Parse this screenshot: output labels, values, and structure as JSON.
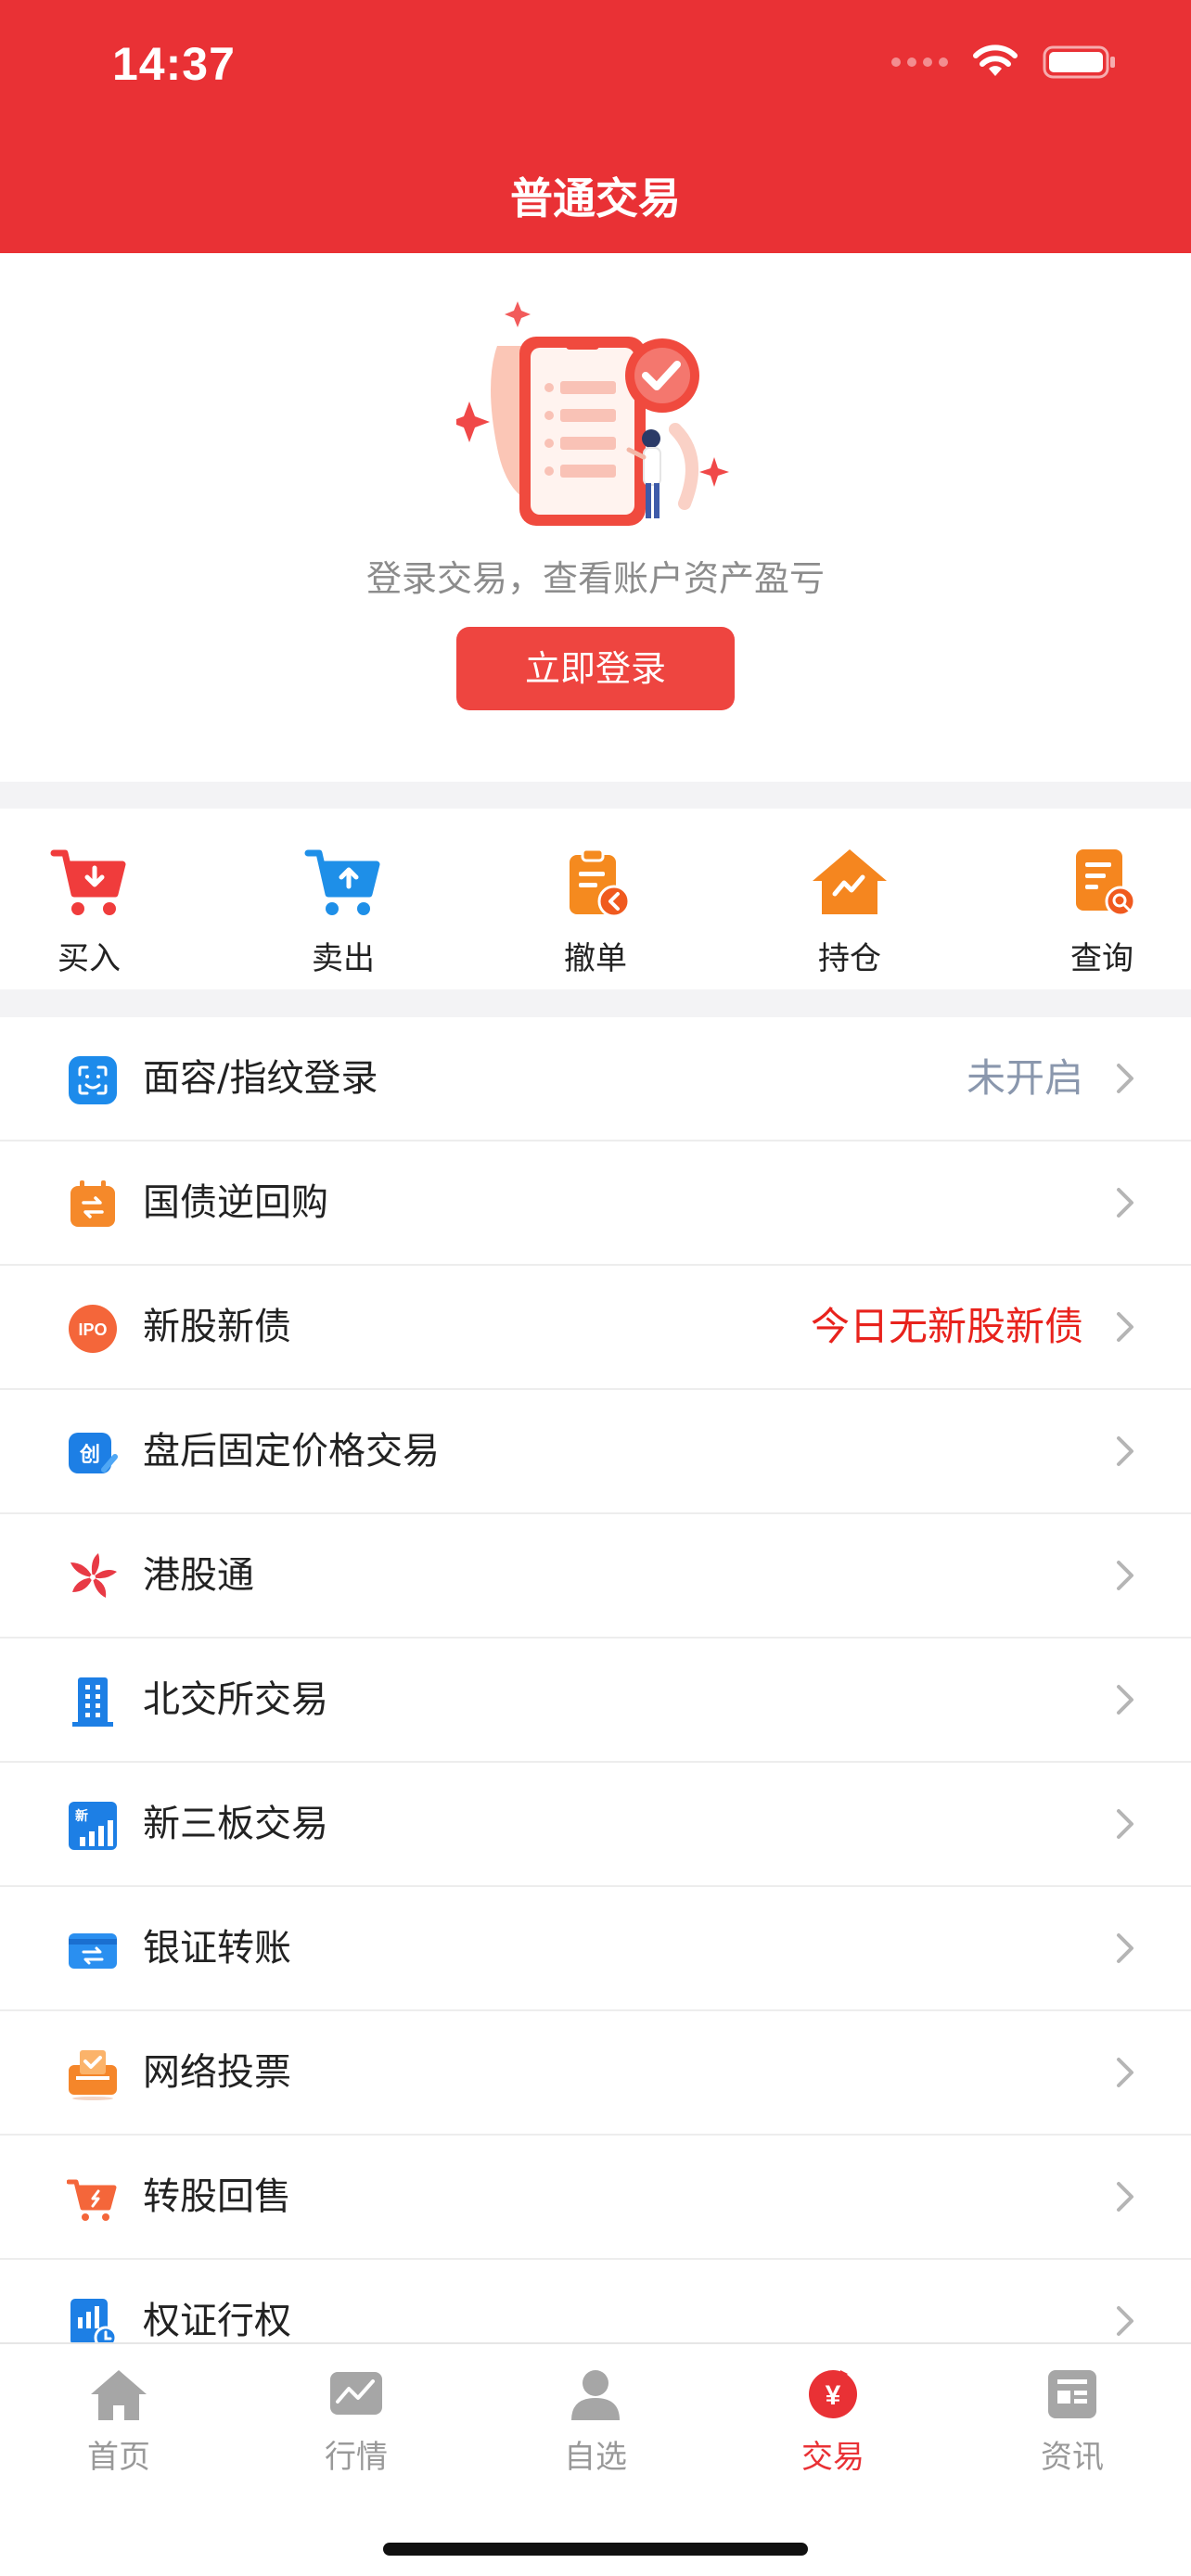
{
  "status_bar": {
    "time": "14:37"
  },
  "nav": {
    "title": "普通交易"
  },
  "hero": {
    "message": "登录交易，查看账户资产盈亏",
    "login_button": "立即登录"
  },
  "quick_actions": [
    {
      "label": "买入",
      "icon": "cart-buy-icon"
    },
    {
      "label": "卖出",
      "icon": "cart-sell-icon"
    },
    {
      "label": "撤单",
      "icon": "cancel-order-icon"
    },
    {
      "label": "持仓",
      "icon": "holdings-icon"
    },
    {
      "label": "查询",
      "icon": "query-icon"
    }
  ],
  "menu": [
    {
      "label": "面容/指纹登录",
      "value": "未开启",
      "icon": "face-id-icon"
    },
    {
      "label": "国债逆回购",
      "value": "",
      "icon": "repo-calendar-icon"
    },
    {
      "label": "新股新债",
      "value": "今日无新股新债",
      "icon": "ipo-icon"
    },
    {
      "label": "盘后固定价格交易",
      "value": "",
      "icon": "chuang-icon"
    },
    {
      "label": "港股通",
      "value": "",
      "icon": "bauhinia-icon"
    },
    {
      "label": "北交所交易",
      "value": "",
      "icon": "building-icon"
    },
    {
      "label": "新三板交易",
      "value": "",
      "icon": "new-board-icon"
    },
    {
      "label": "银证转账",
      "value": "",
      "icon": "bank-transfer-icon"
    },
    {
      "label": "网络投票",
      "value": "",
      "icon": "vote-icon"
    },
    {
      "label": "转股回售",
      "value": "",
      "icon": "resale-cart-icon"
    },
    {
      "label": "权证行权",
      "value": "",
      "icon": "warrant-icon"
    }
  ],
  "tabs": [
    {
      "label": "首页",
      "icon": "home-icon",
      "active": false
    },
    {
      "label": "行情",
      "icon": "market-icon",
      "active": false
    },
    {
      "label": "自选",
      "icon": "person-icon",
      "active": false
    },
    {
      "label": "交易",
      "icon": "trade-yen-icon",
      "active": true
    },
    {
      "label": "资讯",
      "icon": "news-icon",
      "active": false
    }
  ],
  "colors": {
    "brand_red": "#E93135",
    "value_gray": "#8A97AD",
    "value_red": "#E8221C",
    "inactive_tab": "#999999"
  }
}
